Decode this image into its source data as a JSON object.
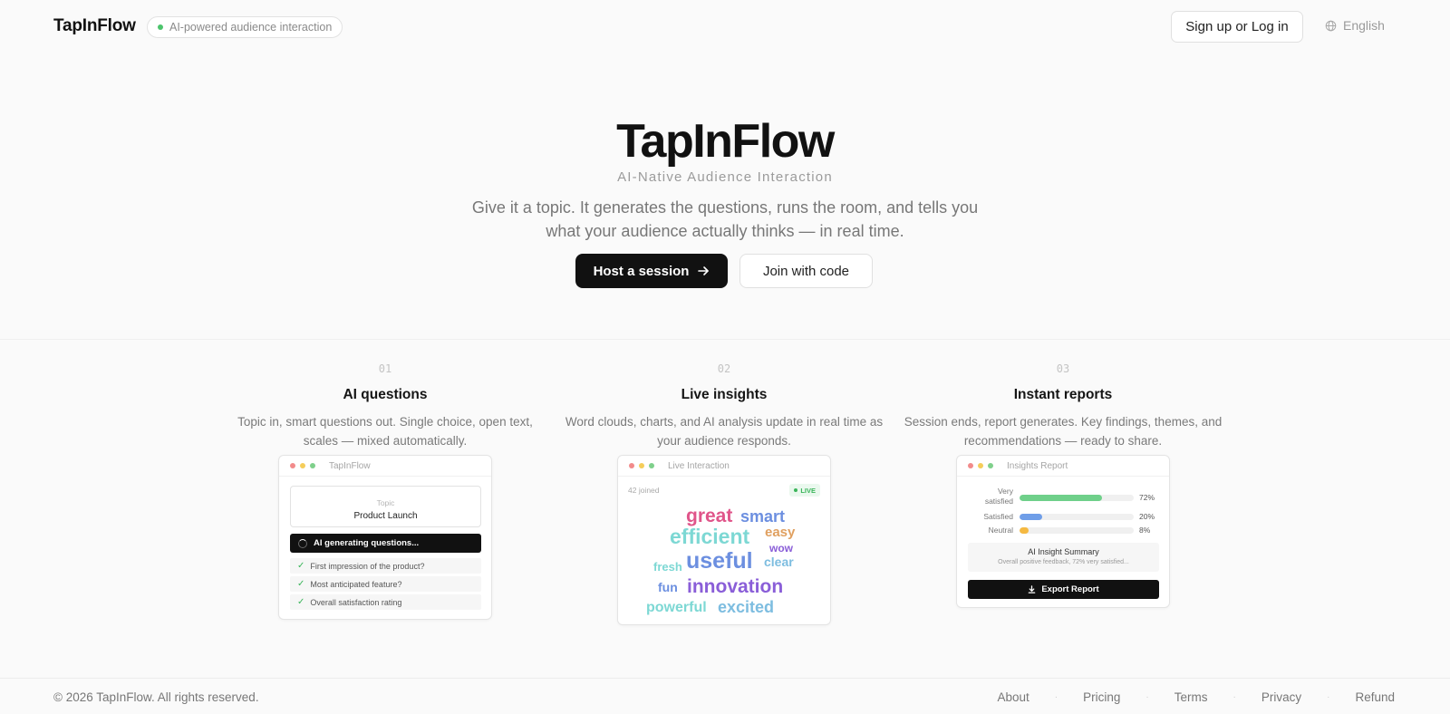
{
  "header": {
    "logo": "TapInFlow",
    "badge": "AI-powered audience interaction",
    "signup_label": "Sign up or Log in",
    "language": "English"
  },
  "hero": {
    "title": "TapInFlow",
    "subtitle": "AI-Native Audience Interaction",
    "description": "Give it a topic. It generates the questions, runs the room, and tells you what your audience actually thinks — in real time.",
    "host_label": "Host a session",
    "join_label": "Join with code"
  },
  "features": [
    {
      "number": "01",
      "title": "AI questions",
      "description": "Topic in, smart questions out. Single choice, open text, scales — mixed automatically.",
      "card": {
        "title": "TapInFlow",
        "topic_label": "Topic",
        "topic_value": "Product Launch",
        "generating": "AI generating questions...",
        "questions": [
          "First impression of the product?",
          "Most anticipated feature?",
          "Overall satisfaction rating"
        ]
      }
    },
    {
      "number": "02",
      "title": "Live insights",
      "description": "Word clouds, charts, and AI analysis update in real time as your audience responds.",
      "card": {
        "title": "Live Interaction",
        "joined": "42 joined",
        "live": "LIVE",
        "words": [
          "great",
          "smart",
          "efficient",
          "easy",
          "wow",
          "fresh",
          "useful",
          "clear",
          "fun",
          "innovation",
          "powerful",
          "excited"
        ]
      }
    },
    {
      "number": "03",
      "title": "Instant reports",
      "description": "Session ends, report generates. Key findings, themes, and recommendations — ready to share.",
      "card": {
        "title": "Insights Report",
        "rows": [
          {
            "label": "Very satisfied",
            "value": 72,
            "display": "72%",
            "color": "#6fd08a"
          },
          {
            "label": "Satisfied",
            "value": 20,
            "display": "20%",
            "color": "#6f9ee8"
          },
          {
            "label": "Neutral",
            "value": 8,
            "display": "8%",
            "color": "#f5b942"
          }
        ],
        "summary_title": "AI Insight Summary",
        "summary_text": "Overall positive feedback, 72% very satisfied...",
        "export_label": "Export Report"
      }
    }
  ],
  "footer": {
    "copyright": "© 2026 TapInFlow. All rights reserved.",
    "links": [
      "About",
      "Pricing",
      "Terms",
      "Privacy",
      "Refund"
    ]
  },
  "colors": {
    "accent": "#111111",
    "live_green": "#3bb55a",
    "word_pink": "#e0558a",
    "word_blue": "#6c8fe0",
    "word_teal": "#7dd8d4",
    "word_orange": "#e0a060",
    "word_purple": "#8a5ed8"
  }
}
